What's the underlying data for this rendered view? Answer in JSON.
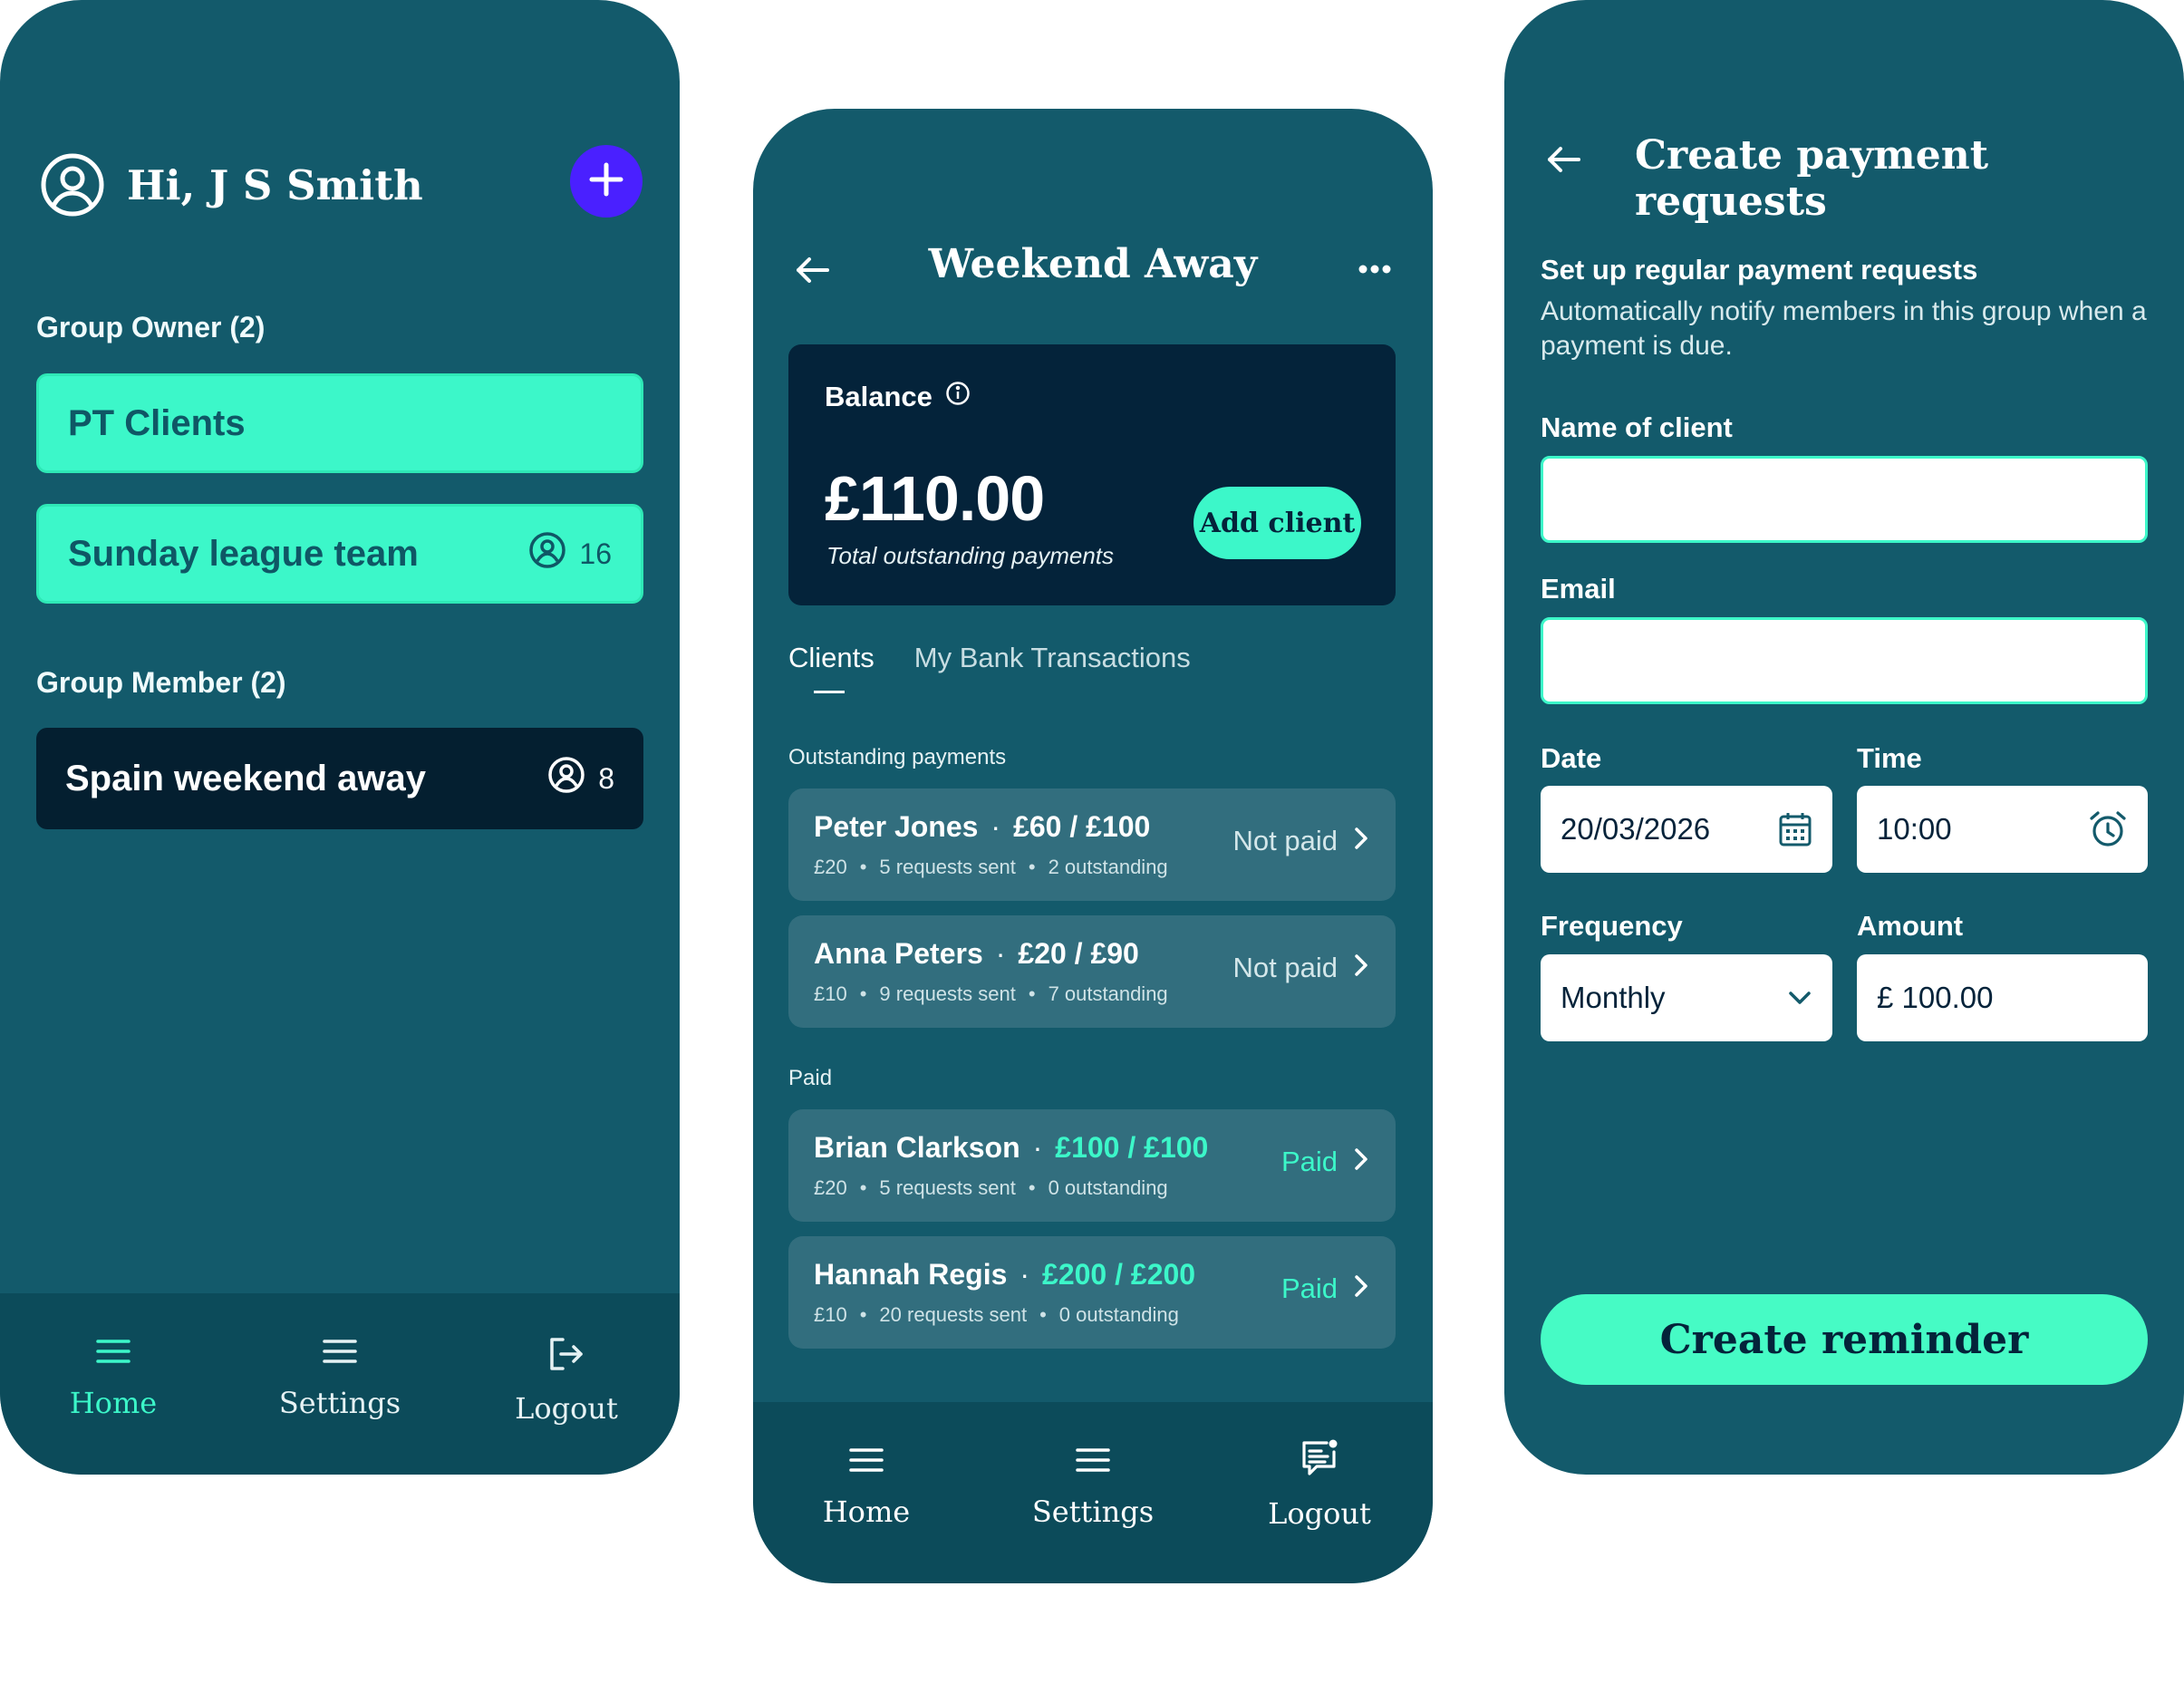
{
  "home": {
    "greeting": "Hi, J S Smith",
    "owner_label": "Group Owner (2)",
    "owner_groups": [
      {
        "name": "PT Clients",
        "count": ""
      },
      {
        "name": "Sunday league team",
        "count": "16"
      }
    ],
    "member_label": "Group Member (2)",
    "member_groups": [
      {
        "name": "Spain weekend away",
        "count": "8"
      }
    ],
    "nav": {
      "home": "Home",
      "settings": "Settings",
      "logout": "Logout"
    }
  },
  "group": {
    "title": "Weekend Away",
    "balance_label": "Balance",
    "balance_amount": "£110.00",
    "balance_sub": "Total outstanding payments",
    "add_client": "Add client",
    "tabs": [
      "Clients",
      "My Bank Transactions"
    ],
    "outstanding_label": "Outstanding payments",
    "paid_label": "Paid",
    "outstanding": [
      {
        "name": "Peter Jones",
        "amount": "£60 / £100",
        "rate": "£20",
        "sent": "5 requests sent",
        "out": "2 outstanding",
        "status": "Not paid"
      },
      {
        "name": "Anna Peters",
        "amount": "£20 / £90",
        "rate": "£10",
        "sent": "9 requests sent",
        "out": "7 outstanding",
        "status": "Not paid"
      }
    ],
    "paid": [
      {
        "name": "Brian Clarkson",
        "amount": "£100 / £100",
        "rate": "£20",
        "sent": "5 requests sent",
        "out": "0 outstanding",
        "status": "Paid"
      },
      {
        "name": "Hannah Regis",
        "amount": "£200 / £200",
        "rate": "£10",
        "sent": "20 requests sent",
        "out": "0 outstanding",
        "status": "Paid"
      }
    ],
    "nav": {
      "home": "Home",
      "settings": "Settings",
      "logout": "Logout"
    }
  },
  "create": {
    "title": "Create payment requests",
    "heading": "Set up regular payment requests",
    "description": "Automatically notify members in this group when a payment is due.",
    "name_label": "Name of client",
    "name_value": "",
    "email_label": "Email",
    "email_value": "",
    "date_label": "Date",
    "date_value": "20/03/2026",
    "time_label": "Time",
    "time_value": "10:00",
    "frequency_label": "Frequency",
    "frequency_value": "Monthly",
    "amount_label": "Amount",
    "amount_value": "£ 100.00",
    "cta": "Create reminder"
  },
  "colors": {
    "background": "#135a6b",
    "accent": "#3cf7c9",
    "dark": "#04233a",
    "fab": "#4a20ff"
  }
}
